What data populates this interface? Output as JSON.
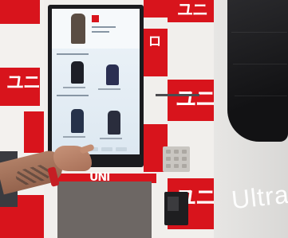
{
  "scene": {
    "description_colors": {
      "brand_red": "#d8141c",
      "wall_white": "#f1efec",
      "screen_blue": "#e3edf5",
      "jacket_black": "#1c1c1f"
    },
    "logo_text": "UNI",
    "banner_text": "Ultra L",
    "icons": [
      "kiosk-screen",
      "keypad-icon",
      "card-reader-icon",
      "pickup-tray"
    ]
  }
}
